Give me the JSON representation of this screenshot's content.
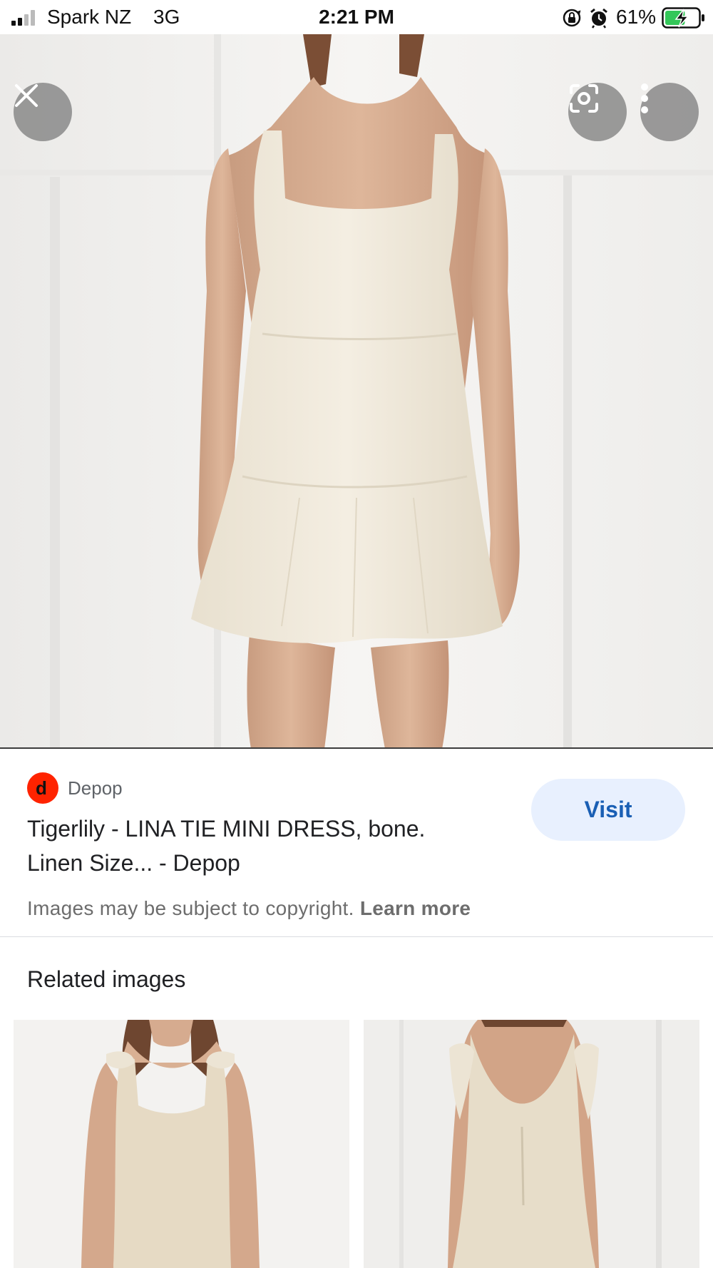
{
  "status_bar": {
    "carrier": "Spark NZ",
    "network": "3G",
    "time": "2:21 PM",
    "battery_percent": "61%",
    "battery_level": 0.61,
    "signal_bars": 2,
    "icons": [
      "signal-icon",
      "orientation-lock-icon",
      "alarm-icon",
      "battery-charging-icon"
    ]
  },
  "viewer": {
    "image_subject": "bone linen mini dress",
    "buttons": [
      "close-icon",
      "lens-icon",
      "more-vert-icon"
    ]
  },
  "result": {
    "source_logo_letter": "d",
    "source_name": "Depop",
    "title": "Tigerlily - LINA TIE MINI DRESS, bone. Linen Size... - Depop",
    "visit_label": "Visit",
    "copyright_text": "Images may be subject to copyright.",
    "learn_more": "Learn more"
  },
  "related": {
    "heading": "Related images"
  },
  "colors": {
    "accent_blue": "#1a5fb4",
    "visit_bg": "#e8f0fe",
    "depop_red": "#ff2300",
    "battery_green": "#34c759"
  }
}
